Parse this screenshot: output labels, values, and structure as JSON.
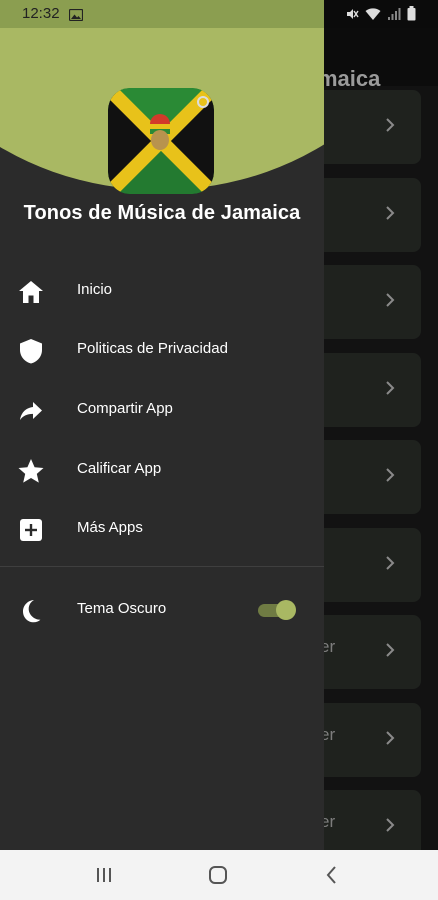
{
  "status_bar": {
    "time": "12:32"
  },
  "background_app": {
    "title_partial": "maica",
    "cards": [
      {
        "text": ""
      },
      {
        "text": ""
      },
      {
        "text": ""
      },
      {
        "text": ""
      },
      {
        "text": ""
      },
      {
        "text": ""
      },
      {
        "text": "er"
      },
      {
        "text": "er"
      },
      {
        "text": "er"
      }
    ]
  },
  "drawer": {
    "app_title": "Tonos de Música de Jamaica",
    "menu": [
      {
        "label": "Inicio",
        "icon": "home-icon"
      },
      {
        "label": "Politicas de Privacidad",
        "icon": "shield-icon"
      },
      {
        "label": "Compartir App",
        "icon": "share-icon"
      },
      {
        "label": "Calificar App",
        "icon": "star-icon"
      },
      {
        "label": "Más Apps",
        "icon": "add-box-icon"
      }
    ],
    "dark_theme": {
      "label": "Tema Oscuro",
      "enabled": true
    }
  },
  "colors": {
    "accent": "#a9b863",
    "drawer_bg": "#2b2b2b",
    "status_bar_left": "#8b9e50"
  }
}
